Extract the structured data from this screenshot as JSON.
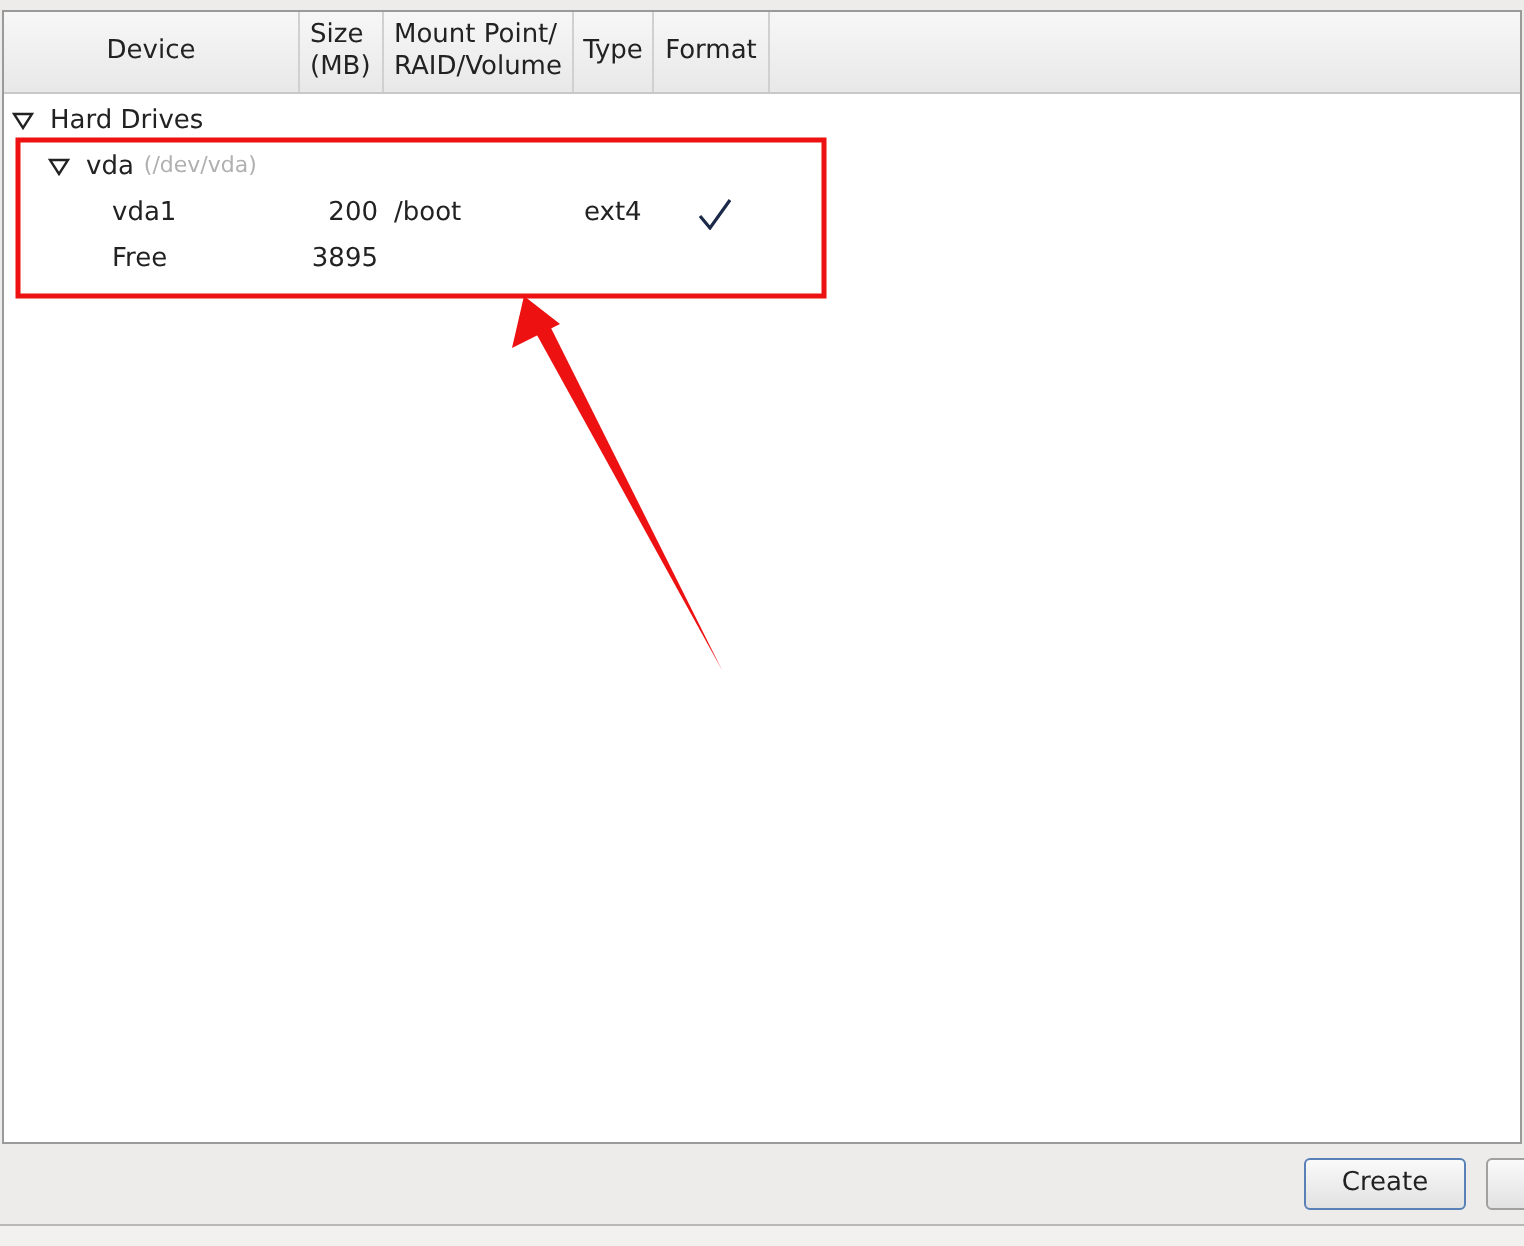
{
  "table": {
    "columns": [
      {
        "lines": [
          "Device"
        ]
      },
      {
        "lines": [
          "Size",
          "(MB)"
        ]
      },
      {
        "lines": [
          "Mount Point/",
          "RAID/Volume"
        ]
      },
      {
        "lines": [
          "Type"
        ]
      },
      {
        "lines": [
          "Format"
        ]
      }
    ],
    "tree": [
      {
        "device": "Hard Drives",
        "expanded": true,
        "children": [
          {
            "device": "vda",
            "path": "(/dev/vda)",
            "expanded": true,
            "children": [
              {
                "device": "vda1",
                "size": "200",
                "mount_point": "/boot",
                "type": "ext4",
                "format": true
              },
              {
                "device": "Free",
                "size": "3895"
              }
            ]
          }
        ]
      }
    ]
  },
  "buttons": [
    {
      "label": "Create",
      "focused": true
    }
  ]
}
